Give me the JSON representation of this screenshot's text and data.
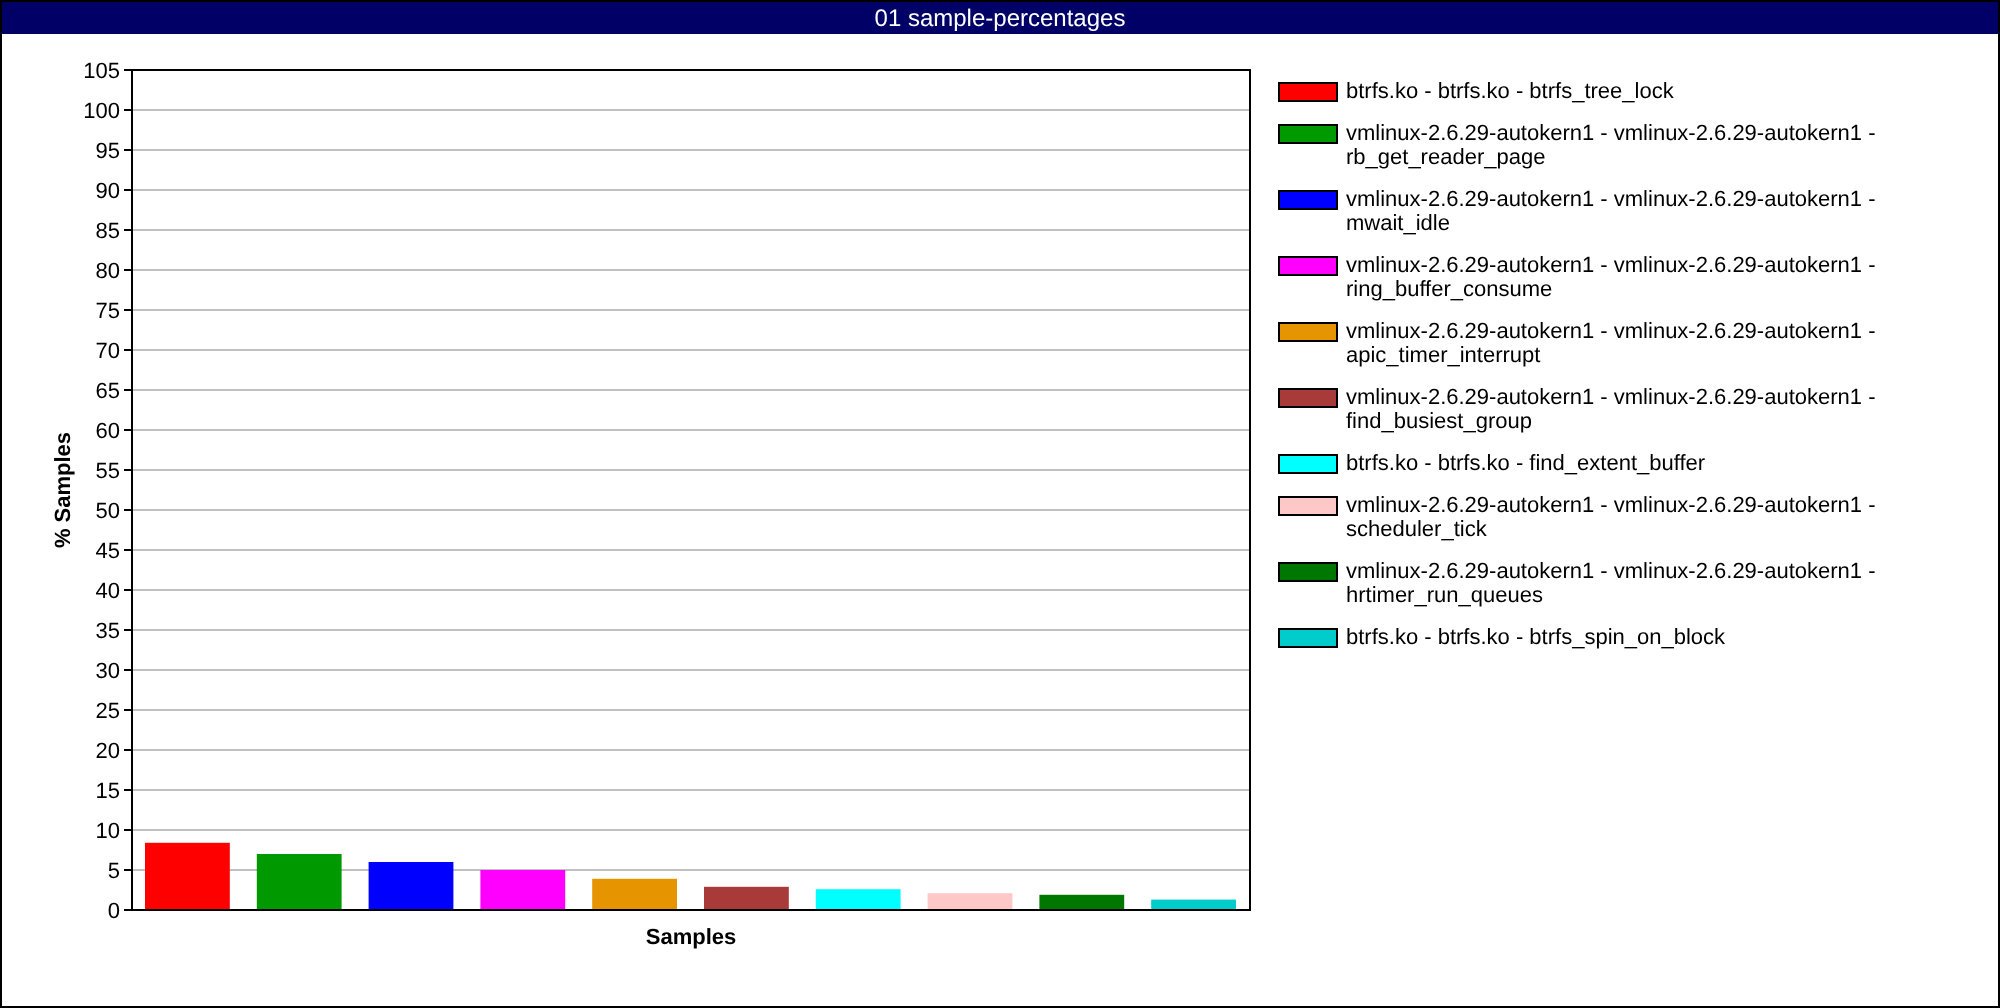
{
  "window": {
    "title": "01 sample-percentages"
  },
  "chart": {
    "chart_data": {
      "type": "bar",
      "xlabel": "Samples",
      "ylabel": "% Samples",
      "grid": "y",
      "ylim": [
        0,
        105
      ],
      "yticks": [
        0,
        5,
        10,
        15,
        20,
        25,
        30,
        35,
        40,
        45,
        50,
        55,
        60,
        65,
        70,
        75,
        80,
        85,
        90,
        95,
        100,
        105
      ],
      "series": [
        {
          "name": "btrfs.ko - btrfs.ko - btrfs_tree_lock",
          "color": "#ff0000",
          "values": [
            8.4
          ]
        },
        {
          "name": "vmlinux-2.6.29-autokern1 - vmlinux-2.6.29-autokern1 - rb_get_reader_page",
          "color": "#009900",
          "values": [
            7.0
          ]
        },
        {
          "name": "vmlinux-2.6.29-autokern1 - vmlinux-2.6.29-autokern1 - mwait_idle",
          "color": "#0000ff",
          "values": [
            6.0
          ]
        },
        {
          "name": "vmlinux-2.6.29-autokern1 - vmlinux-2.6.29-autokern1 - ring_buffer_consume",
          "color": "#ff00ff",
          "values": [
            5.0
          ]
        },
        {
          "name": "vmlinux-2.6.29-autokern1 - vmlinux-2.6.29-autokern1 - apic_timer_interrupt",
          "color": "#e69500",
          "values": [
            3.9
          ]
        },
        {
          "name": "vmlinux-2.6.29-autokern1 - vmlinux-2.6.29-autokern1 - find_busiest_group",
          "color": "#a83a3a",
          "values": [
            2.9
          ]
        },
        {
          "name": "btrfs.ko - btrfs.ko - find_extent_buffer",
          "color": "#00ffff",
          "values": [
            2.6
          ]
        },
        {
          "name": "vmlinux-2.6.29-autokern1 - vmlinux-2.6.29-autokern1 - scheduler_tick",
          "color": "#ffc8c8",
          "values": [
            2.1
          ]
        },
        {
          "name": "vmlinux-2.6.29-autokern1 - vmlinux-2.6.29-autokern1 - hrtimer_run_queues",
          "color": "#007700",
          "values": [
            1.9
          ]
        },
        {
          "name": "btrfs.ko - btrfs.ko - btrfs_spin_on_block",
          "color": "#00cccc",
          "values": [
            1.3
          ]
        }
      ]
    }
  }
}
